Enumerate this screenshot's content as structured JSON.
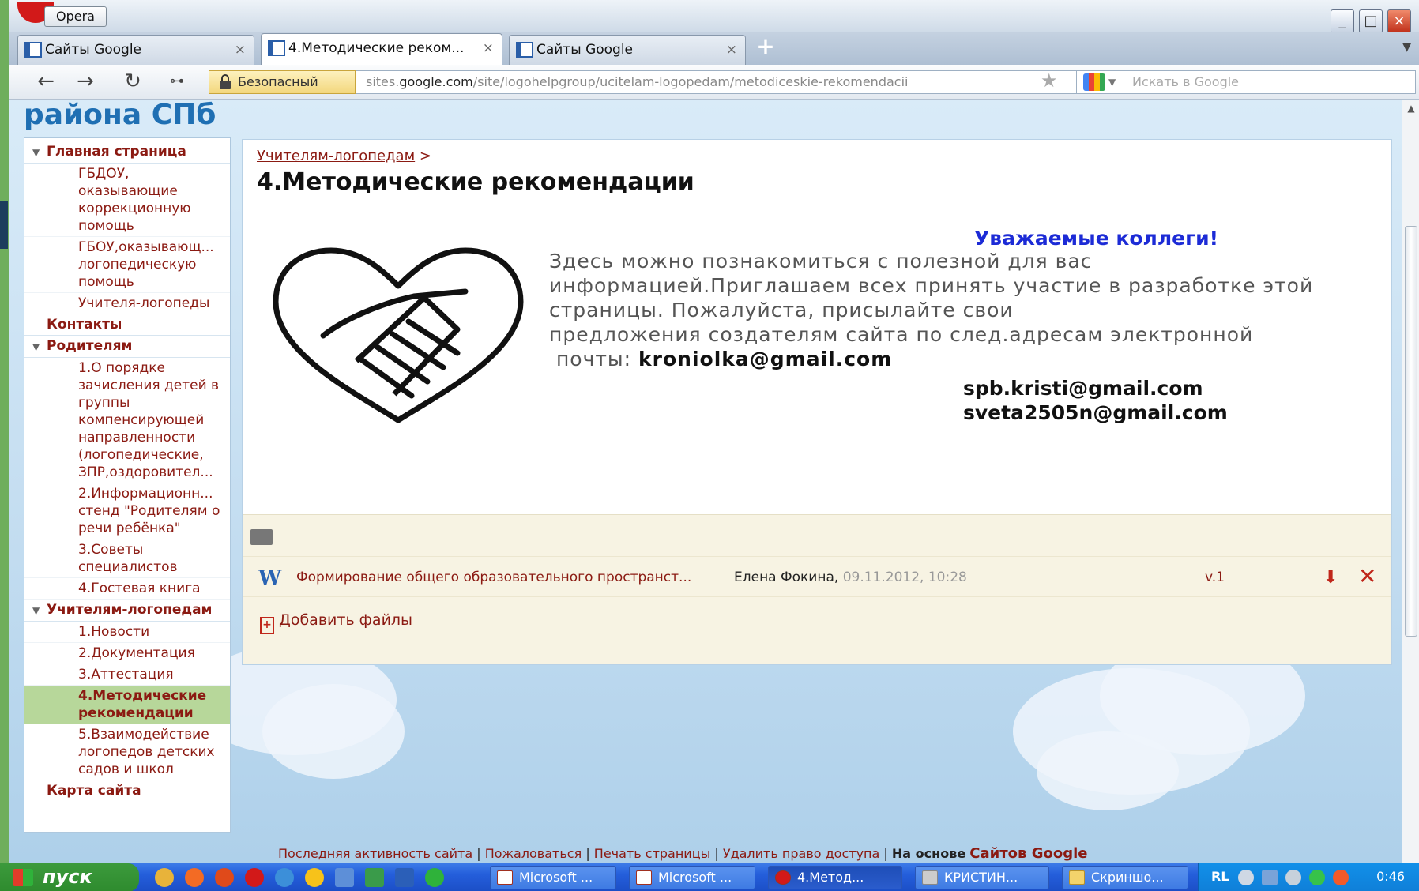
{
  "browser": {
    "menu_label": "Opera",
    "tabs": [
      {
        "label": "Сайты Google",
        "close": "×"
      },
      {
        "label": "4.Методические реком...",
        "close": "×"
      },
      {
        "label": "Сайты Google",
        "close": "×"
      }
    ],
    "new_tab": "+",
    "security_label": "Безопасный",
    "url_prefix": "sites.",
    "url_host": "google.com",
    "url_path": "/site/logohelpgroup/ucitelam-logopedam/metodiceskie-rekomendacii",
    "search_placeholder": "Искать в Google"
  },
  "site": {
    "title": "района СПб",
    "sidebar": {
      "home": "Главная страница",
      "home_items": [
        {
          "label": "ГБДОУ, оказывающие коррекционную помощь"
        },
        {
          "label": "ГБОУ,оказывающ... логопедическую помощь"
        },
        {
          "label": "Учителя-логопеды"
        }
      ],
      "contacts": "Контакты",
      "parents": "Родителям",
      "parents_items": [
        {
          "label": "1.О порядке зачисления детей в группы компенсирующей направленности (логопедические, ЗПР,оздоровител..."
        },
        {
          "label": "2.Информационн... стенд \"Родителям о речи ребёнка\""
        },
        {
          "label": "3.Советы специалистов"
        },
        {
          "label": "4.Гостевая книга"
        }
      ],
      "teachers": "Учителям-логопедам",
      "teachers_items": [
        {
          "label": "1.Новости"
        },
        {
          "label": "2.Документация"
        },
        {
          "label": "3.Аттестация"
        },
        {
          "label": "4.Методические рекомендации"
        },
        {
          "label": "5.Взаимодействие логопедов детских садов и школ"
        }
      ],
      "sitemap": "Карта сайта"
    },
    "breadcrumb": {
      "link": "Учителям-логопедам",
      "sep": ">"
    },
    "page_title": "4.Методические рекомендации",
    "greeting": "Уважаемые коллеги!",
    "body_lines": [
      "Здесь  можно познакомиться с полезной для вас",
      "информацией.Приглашаем всех принять участие в разработке этой",
      "страницы. Пожалуйста,  присылайте свои",
      "предложения создателям сайта по след.адресам электронной"
    ],
    "emails_prefix": " почты: ",
    "email1": "kroniolka@gmail.com",
    "email2": "spb.kristi@gmail.com",
    "email3": "sveta2505n@gmail.com",
    "attachment": {
      "icon": "W",
      "name": "Формирование общего образовательного пространст...",
      "author": "Елена Фокина,",
      "date": "09.11.2012, 10:28",
      "version": "v.1"
    },
    "add_files": "Добавить файлы",
    "footer": {
      "activity": "Последняя активность сайта",
      "report": "Пожаловаться",
      "print": "Печать страницы",
      "remove_access": "Удалить право доступа",
      "sep": "|",
      "based_on": "На основе",
      "google_sites": "Сайтов Google"
    }
  },
  "taskbar": {
    "start": "пуск",
    "windows": [
      {
        "label": "Microsoft ..."
      },
      {
        "label": "Microsoft ..."
      },
      {
        "label": "4.Метод..."
      },
      {
        "label": "КРИСТИН..."
      },
      {
        "label": "Скриншо..."
      }
    ],
    "lang": "RL",
    "clock": "0:46"
  },
  "colors": {
    "link": "#8b1a12",
    "greeting": "#1c2bd6",
    "site_title": "#1f6fb3",
    "active_nav": "#b7d79a"
  }
}
